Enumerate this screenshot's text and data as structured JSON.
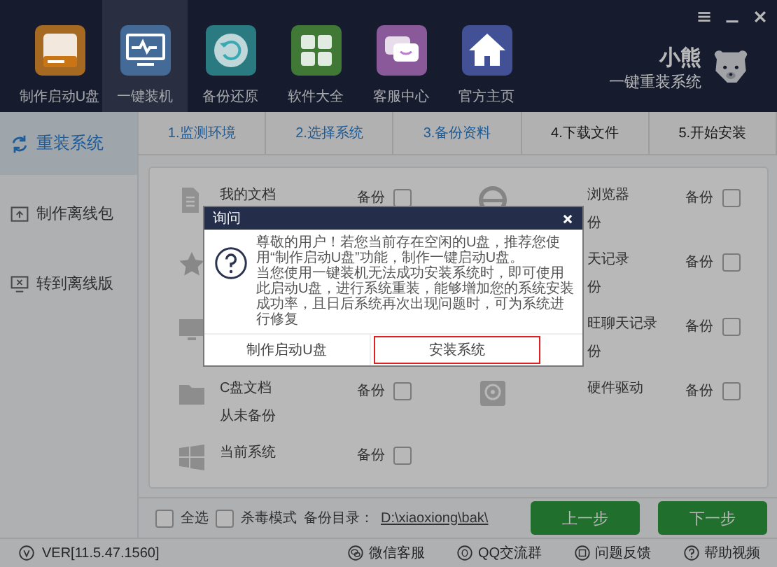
{
  "nav": [
    {
      "label": "制作启动U盘",
      "kind": "disk",
      "color": "#a56922",
      "selected": false
    },
    {
      "label": "一键装机",
      "kind": "monitor",
      "color": "#446a98",
      "selected": true
    },
    {
      "label": "备份还原",
      "kind": "restore",
      "color": "#297a81",
      "selected": false
    },
    {
      "label": "软件大全",
      "kind": "grid",
      "color": "#3f7935",
      "selected": false
    },
    {
      "label": "客服中心",
      "kind": "chat",
      "color": "#8a5999",
      "selected": false
    },
    {
      "label": "官方主页",
      "kind": "home",
      "color": "#425095",
      "selected": false
    }
  ],
  "brand": {
    "name": "小熊",
    "tagline": "一键重装系统"
  },
  "sidebar": [
    {
      "label": "重装系统",
      "kind": "refresh",
      "selected": true
    },
    {
      "label": "制作离线包",
      "kind": "upload",
      "selected": false
    },
    {
      "label": "转到离线版",
      "kind": "screen",
      "selected": false
    }
  ],
  "steps": [
    {
      "label": "1.监测环境",
      "done": true
    },
    {
      "label": "2.选择系统",
      "done": true
    },
    {
      "label": "3.备份资料",
      "done": true
    },
    {
      "label": "4.下载文件",
      "done": false
    },
    {
      "label": "5.开始安装",
      "done": false
    }
  ],
  "backup_items": [
    {
      "kind": "document",
      "label": "我的文档",
      "backup_label": "备份",
      "checked": false
    },
    {
      "kind": "browser",
      "label": "浏览器",
      "status": "份",
      "backup_label": "备份",
      "checked": false
    },
    {
      "kind": "star"
    },
    {
      "label": "天记录",
      "status": "份",
      "backup_label": "备份",
      "checked": false
    },
    {
      "kind": "monitor"
    },
    {
      "label": "旺聊天记录",
      "status": "份",
      "backup_label": "备份",
      "checked": false
    },
    {
      "kind": "folder",
      "label": "C盘文档",
      "status": "从未备份",
      "backup_label": "备份",
      "checked": false
    },
    {
      "kind": "driver",
      "label": "硬件驱动",
      "backup_label": "备份",
      "checked": false
    },
    {
      "kind": "windows",
      "label": "当前系统",
      "backup_label": "备份",
      "checked": false
    }
  ],
  "bottom_bar": {
    "select_all": {
      "label": "全选",
      "checked": false
    },
    "antivirus": {
      "label": "杀毒模式",
      "checked": false
    },
    "backup_dir_label": "备份目录：",
    "backup_dir": "D:\\xiaoxiong\\bak\\",
    "buttons": [
      "上一步",
      "下一步"
    ]
  },
  "status_bar": {
    "version": "VER[11.5.47.1560]",
    "links": [
      {
        "label": "微信客服",
        "kind": "wechat"
      },
      {
        "label": "QQ交流群",
        "kind": "qq"
      },
      {
        "label": "问题反馈",
        "kind": "feedback"
      },
      {
        "label": "帮助视频",
        "kind": "help"
      }
    ]
  },
  "dialog": {
    "title": "询问",
    "paragraphs": [
      "尊敬的用户！若您当前存在空闲的U盘，推荐您使用“制作启动U盘”功能，制作一键启动U盘。",
      "当您使用一键装机无法成功安装系统时，即可使用此启动U盘，进行系统重装，能够增加您的系统安装成功率，且日后系统再次出现问题时，可为系统进行修复"
    ],
    "buttons": [
      {
        "label": "制作启动U盘",
        "highlighted": false
      },
      {
        "label": "安装系统",
        "highlighted": true
      }
    ]
  }
}
